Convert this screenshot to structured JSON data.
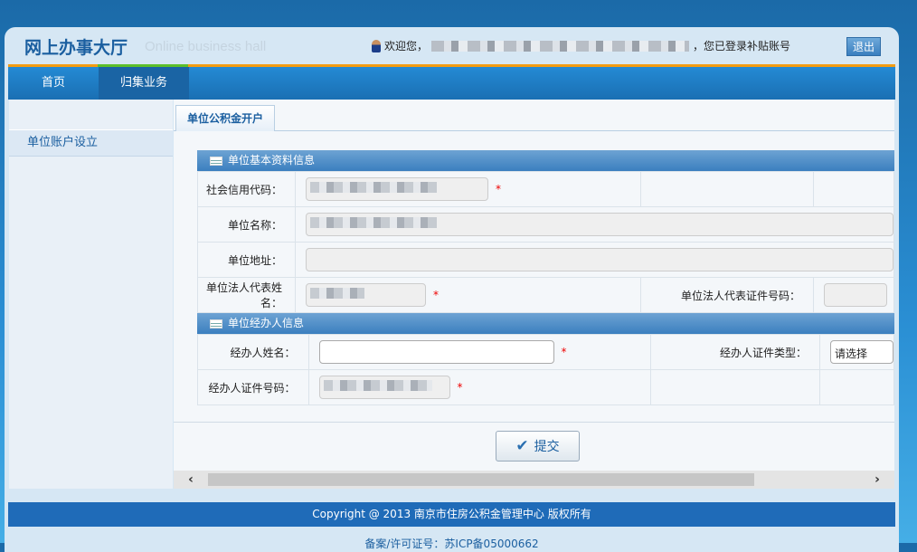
{
  "header": {
    "title": "网上办事大厅",
    "subtitle": "Online business hall",
    "welcome": "欢迎您，",
    "login_note": "，您已登录补贴账号",
    "logout": "退出"
  },
  "nav": [
    {
      "label": "首页"
    },
    {
      "label": "归集业务"
    }
  ],
  "sidebar": {
    "items": [
      {
        "label": "单位账户设立"
      }
    ]
  },
  "tab": "单位公积金开户",
  "sections": {
    "basic": {
      "title": "单位基本资料信息",
      "credit_code": "社会信用代码：",
      "name": "单位名称：",
      "address": "单位地址：",
      "legal_name": "单位法人代表姓名：",
      "legal_id": "单位法人代表证件号码："
    },
    "agent": {
      "title": "单位经办人信息",
      "name": "经办人姓名：",
      "id_type": "经办人证件类型：",
      "id_type_value": "请选择",
      "id_no": "经办人证件号码："
    }
  },
  "required": "*",
  "submit": "提交",
  "footer": {
    "copyright": "Copyright @ 2013 南京市住房公积金管理中心 版权所有",
    "icp": "备案/许可证号：苏ICP备05000662"
  }
}
